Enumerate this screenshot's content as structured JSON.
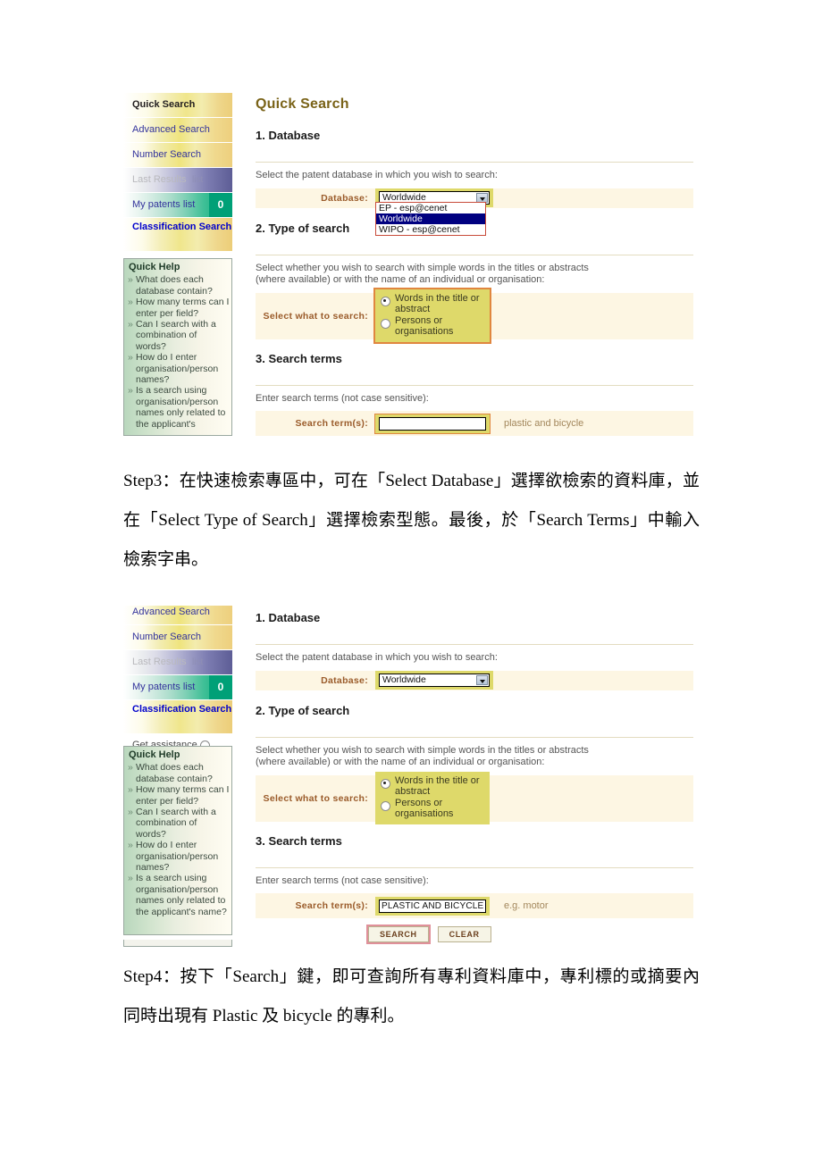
{
  "doc": {
    "step3_text": "Step3：在快速檢索專區中，可在「Select Database」選擇欲檢索的資料庫，並在「Select Type of Search」選擇檢索型態。最後，於「Search Terms」中輸入檢索字串。",
    "step4_text": "Step4：按下「Search」鍵，即可查詢所有專利資料庫中，專利標的或摘要內同時出現有 Plastic 及 bicycle 的專利。"
  },
  "nav": {
    "items": [
      {
        "label": "Quick Search",
        "state": "current"
      },
      {
        "label": "Advanced Search",
        "state": "normal"
      },
      {
        "label": "Number Search",
        "state": "normal"
      },
      {
        "label": "Last Results",
        "extra": "list",
        "state": "disabled"
      },
      {
        "label": "My patents list",
        "badge": "0",
        "state": "teal"
      },
      {
        "label": "Classification Search",
        "state": "classification"
      },
      {
        "label": "Get assistance",
        "state": "plain",
        "icon": "help-circle-icon"
      }
    ],
    "nav2_items": [
      {
        "label": "Advanced Search",
        "state": "normal"
      },
      {
        "label": "Number Search",
        "state": "normal"
      },
      {
        "label": "Last Results",
        "extra": "list",
        "state": "disabled"
      },
      {
        "label": "My patents list",
        "badge": "0",
        "state": "teal"
      },
      {
        "label": "Classification Search",
        "state": "classification"
      },
      {
        "label": "Get assistance",
        "state": "plain",
        "icon": "help-circle-icon"
      }
    ]
  },
  "quick_help": {
    "title": "Quick Help",
    "items": [
      "What does each database contain?",
      "How many terms can I enter per field?",
      "Can I search with a combination of words?",
      "How do I enter organisation/person names?",
      "Is a search using organisation/person names only related to the applicant's name?"
    ],
    "items_clipped": [
      "What does each database contain?",
      "How many terms can I enter per field?",
      "Can I search with a combination of words?",
      "How do I enter organisation/person names?",
      "Is a search using organisation/person names only related to the applicant's"
    ]
  },
  "panel1": {
    "page_title": "Quick Search",
    "section1": {
      "heading": "1. Database",
      "hint": "Select the patent database in which you wish to search:",
      "field_label": "Database:",
      "selected": "Worldwide",
      "options": [
        "EP - esp@cenet",
        "Worldwide",
        "WIPO - esp@cenet"
      ],
      "dropdown_open": true
    },
    "section2": {
      "heading": "2. Type of search",
      "hint_line1": "Select whether you wish to search with simple words in the titles or abstracts",
      "hint_line2": "(where available) or with the name of an individual or organisation:",
      "field_label": "Select what to search:",
      "options": [
        "Words in the title or abstract",
        "Persons or organisations"
      ],
      "selected_index": 0
    },
    "section3": {
      "heading": "3. Search terms",
      "hint": "Enter search terms (not case sensitive):",
      "field_label": "Search term(s):",
      "value": "",
      "example": "plastic and bicycle"
    }
  },
  "panel2": {
    "section1": {
      "heading": "1. Database",
      "hint": "Select the patent database in which you wish to search:",
      "field_label": "Database:",
      "selected": "Worldwide",
      "dropdown_open": false
    },
    "section2": {
      "heading": "2. Type of search",
      "hint_line1": "Select whether you wish to search with simple words in the titles or abstracts",
      "hint_line2": "(where available) or with the name of an individual or organisation:",
      "field_label": "Select what to search:",
      "options": [
        "Words in the title or abstract",
        "Persons or organisations"
      ],
      "selected_index": 0
    },
    "section3": {
      "heading": "3. Search terms",
      "hint": "Enter search terms (not case sensitive):",
      "field_label": "Search term(s):",
      "value": "PLASTIC AND BICYCLE",
      "example": "e.g. motor"
    },
    "buttons": {
      "search": "SEARCH",
      "clear": "CLEAR"
    }
  },
  "colors": {
    "title": "#7a6318",
    "field_label": "#9a5b2a",
    "highlight": "#ded96a",
    "band": "#fdf6e3",
    "focus_outline": "#e0863f",
    "badge": "#00a077",
    "nav_link": "#33339c",
    "select_on": "#000080"
  }
}
